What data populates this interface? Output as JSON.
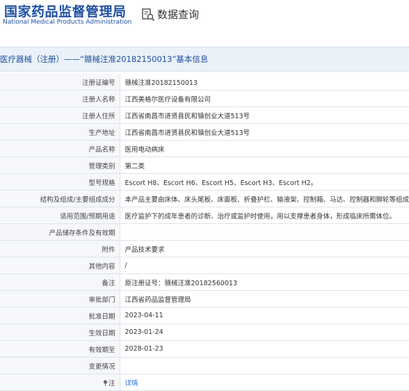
{
  "header": {
    "logo_cn": "国家药品监督管理局",
    "logo_en": "National Medical Products Administration",
    "query_title": "数据查询",
    "query_icon": "search-document-icon"
  },
  "section_title": "医疗器械（注册）——“赣械注准20182150013”基本信息",
  "colors": {
    "brand": "#1e50a2",
    "link": "#1e6fd8",
    "label_bg": "#f5f7fa",
    "section_bg": "#eaf1f8"
  },
  "rows": [
    {
      "label": "注册证编号",
      "value": "赣械注准20182150013"
    },
    {
      "label": "注册人名称",
      "value": "江西美格尔医疗设备有限公司"
    },
    {
      "label": "注册人住所",
      "value": "江西省南昌市进贤县民和镇创业大道513号"
    },
    {
      "label": "生产地址",
      "value": "江西省南昌市进贤县民和镇创业大道513号"
    },
    {
      "label": "产品名称",
      "value": "医用电动病床"
    },
    {
      "label": "管理类别",
      "value": "第二类"
    },
    {
      "label": "型号规格",
      "value": "Escort H8、Escort H6、Escort H5、Escort H3、Escort H2。"
    },
    {
      "label": "结构及组成/主要组成成分",
      "value": "本产品主要由床体、床头尾板、床面板、折叠护栏、输液架、控制箱、马达、控制器和脚轮等组成。"
    },
    {
      "label": "适用范围/预期用途",
      "value": "医疗监护下的成年患者的诊断、治疗或监护时使用，用以支撑患者身体，形成临床所需体位。"
    },
    {
      "label": "产品储存条件及有效期",
      "value": ""
    },
    {
      "label": "附件",
      "value": "产品技术要求"
    },
    {
      "label": "其他内容",
      "value": "/"
    },
    {
      "label": "备注",
      "value": "原注册证号：赣械注准20182560013"
    },
    {
      "label": "审批部门",
      "value": "江西省药品监督管理局"
    },
    {
      "label": "批准日期",
      "value": "2023-04-11"
    },
    {
      "label": "生效日期",
      "value": "2023-01-24"
    },
    {
      "label": "有效期至",
      "value": "2028-01-23"
    },
    {
      "label": "变更情况",
      "value": ""
    }
  ],
  "note_row": {
    "label": "注",
    "link": "详情",
    "icon": "pin-icon"
  }
}
